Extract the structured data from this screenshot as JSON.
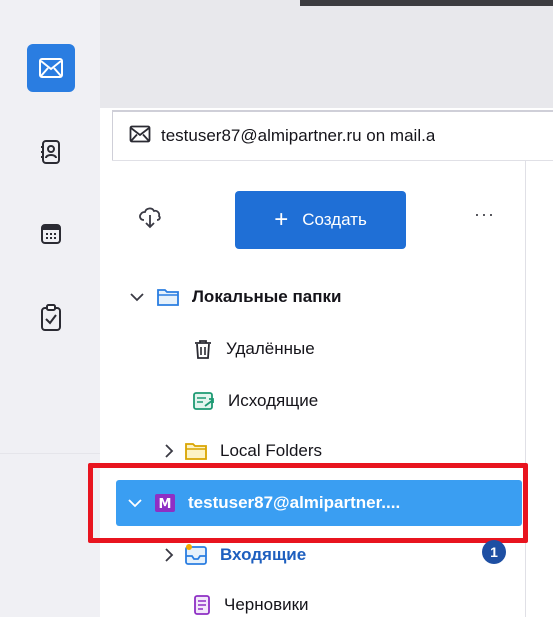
{
  "spaces": {
    "items": [
      {
        "id": "mail",
        "icon": "envelope-icon",
        "active": true
      },
      {
        "id": "address-book",
        "icon": "address-book-icon",
        "active": false
      },
      {
        "id": "calendar",
        "icon": "calendar-icon",
        "active": false
      },
      {
        "id": "tasks",
        "icon": "tasks-icon",
        "active": false
      }
    ]
  },
  "tab": {
    "title": "testuser87@almipartner.ru on mail.a",
    "icon": "envelope-icon"
  },
  "toolbar": {
    "get_messages_icon": "cloud-download-icon",
    "new_label": "Создать",
    "new_icon": "plus-icon",
    "more_label": "···"
  },
  "folders": {
    "local_group": {
      "label": "Локальные папки",
      "expanded": true,
      "icon": "folder-icon"
    },
    "trash": {
      "label": "Удалённые",
      "icon": "trash-icon"
    },
    "outbox": {
      "label": "Исходящие",
      "icon": "outbox-icon"
    },
    "local_folders": {
      "label": "Local Folders",
      "expanded": false,
      "icon": "folder-icon"
    },
    "account": {
      "label": "testuser87@almipartner....",
      "expanded": true,
      "icon": "mail-account-icon",
      "icon_letter": "M",
      "selected": true
    },
    "inbox": {
      "label": "Входящие",
      "unread": "1",
      "icon": "inbox-icon"
    },
    "drafts": {
      "label": "Черновики",
      "icon": "drafts-icon"
    }
  },
  "colors": {
    "accent": "#1f6fd6",
    "selection": "#3a9ef2",
    "highlight_box": "#e8141f",
    "unread_link": "#1e5fbf"
  }
}
